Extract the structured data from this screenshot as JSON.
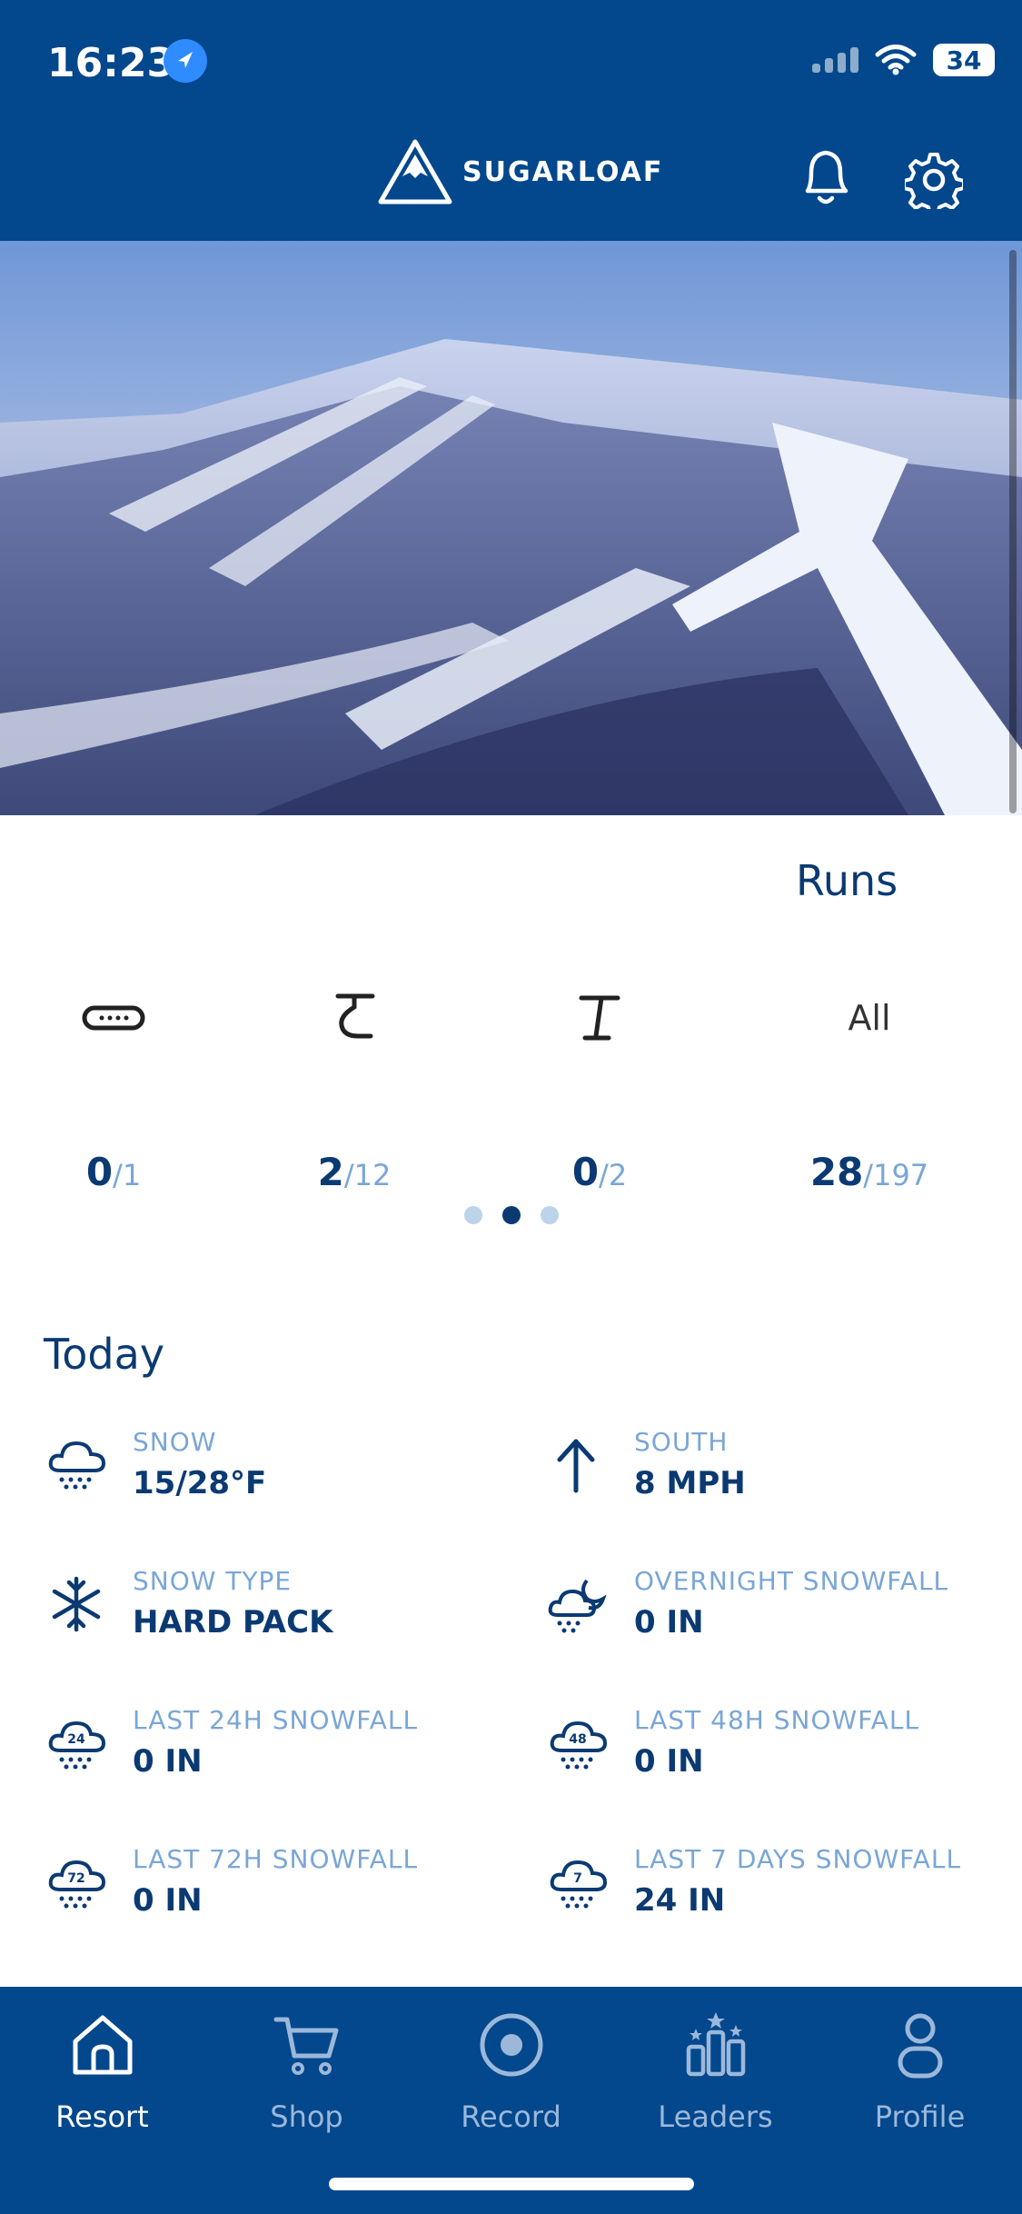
{
  "status": {
    "time": "16:23",
    "battery": "34"
  },
  "header": {
    "brand": "SUGARLOAF"
  },
  "runs": {
    "title": "Runs",
    "cols": [
      {
        "icon": "terrain-park-icon",
        "value": "0",
        "total": "/1"
      },
      {
        "icon": "surface-lift-icon",
        "value": "2",
        "total": "/12"
      },
      {
        "icon": "t-bar-icon",
        "value": "0",
        "total": "/2"
      },
      {
        "label": "All",
        "value": "28",
        "total": "/197"
      }
    ]
  },
  "today": {
    "title": "Today",
    "stats": [
      {
        "icon": "snow-cloud-icon",
        "label": "SNOW",
        "value": "15/28°F"
      },
      {
        "icon": "arrow-up-icon",
        "label": "SOUTH",
        "value": "8 MPH"
      },
      {
        "icon": "snowflake-icon",
        "label": "SNOW TYPE",
        "value": "HARD PACK"
      },
      {
        "icon": "cloud-moon-icon",
        "label": "OVERNIGHT SNOWFALL",
        "value": "0 IN"
      },
      {
        "icon": "snow-24-icon",
        "label": "LAST 24H SNOWFALL",
        "value": "0 IN",
        "badge": "24"
      },
      {
        "icon": "snow-48-icon",
        "label": "LAST 48H SNOWFALL",
        "value": "0 IN",
        "badge": "48"
      },
      {
        "icon": "snow-72-icon",
        "label": "LAST 72H SNOWFALL",
        "value": "0 IN",
        "badge": "72"
      },
      {
        "icon": "snow-7-icon",
        "label": "LAST 7 DAYS SNOWFALL",
        "value": "24 IN",
        "badge": "7"
      }
    ]
  },
  "tabs": [
    {
      "label": "Resort",
      "icon": "home-icon",
      "active": true
    },
    {
      "label": "Shop",
      "icon": "cart-icon"
    },
    {
      "label": "Record",
      "icon": "record-icon"
    },
    {
      "label": "Leaders",
      "icon": "leaderboard-icon"
    },
    {
      "label": "Profile",
      "icon": "profile-icon"
    }
  ],
  "colors": {
    "brand": "#03478c",
    "text": "#0b3a73",
    "muted": "#7aa6d6"
  }
}
